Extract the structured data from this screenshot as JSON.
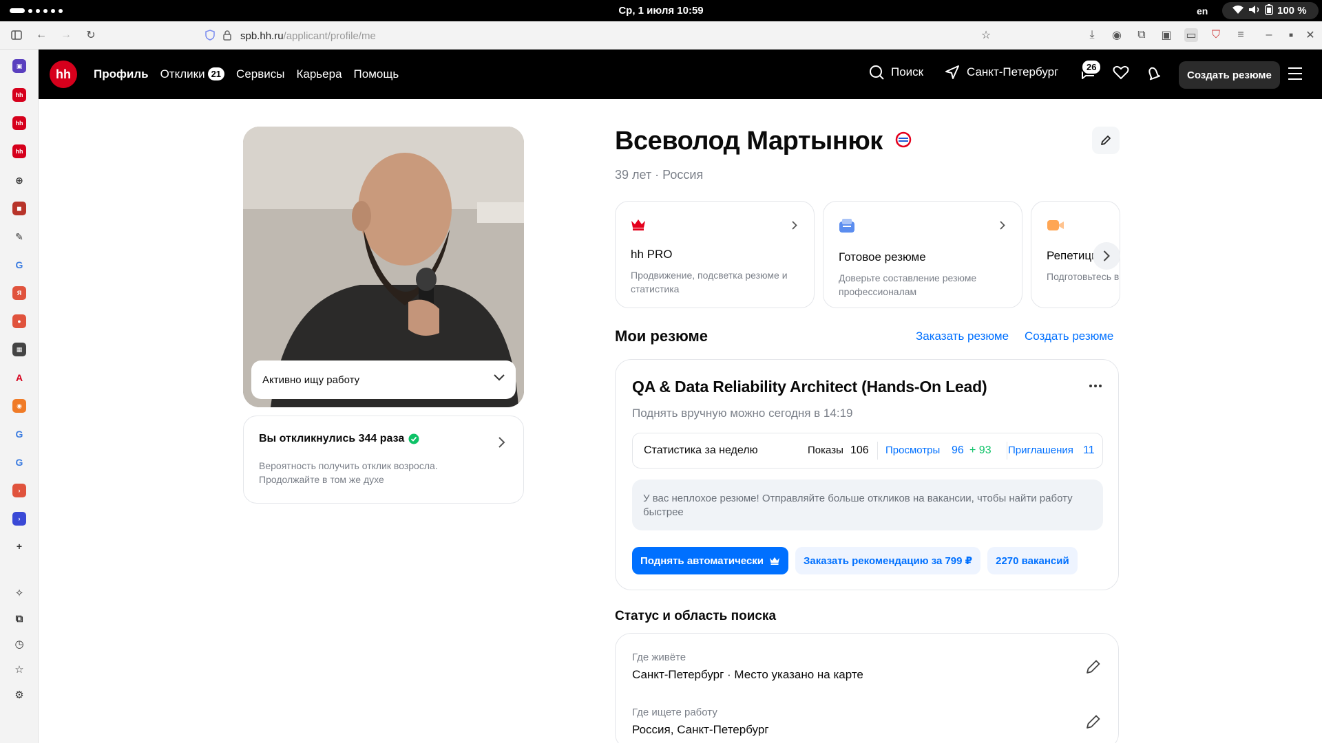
{
  "os": {
    "datetime": "Ср, 1 июля  10:59",
    "lang": "en",
    "battery": "100 %"
  },
  "browser": {
    "url_host": "spb.hh.ru",
    "url_path": "/applicant/profile/me"
  },
  "sidebar_icons": [
    "teams-icon",
    "hh-icon",
    "hh-icon",
    "hh-icon",
    "globe-icon",
    "app-icon",
    "extensions-icon",
    "google-icon",
    "yandex-icon",
    "maps-icon",
    "film-icon",
    "font-icon",
    "firefox-icon",
    "google-icon",
    "google-icon",
    "red-arrow-icon",
    "blue-arrow-icon",
    "add-icon"
  ],
  "header": {
    "logo": "hh",
    "nav": [
      {
        "label": "Профиль",
        "active": true
      },
      {
        "label": "Отклики",
        "badge": "21"
      },
      {
        "label": "Сервисы"
      },
      {
        "label": "Карьера"
      },
      {
        "label": "Помощь"
      }
    ],
    "search_label": "Поиск",
    "location_label": "Санкт-Петербург",
    "notifications_count": "26",
    "create_resume_label": "Создать резюме"
  },
  "profile": {
    "status_select": "Активно ищу работу",
    "responses_title": "Вы откликнулись 344 раза",
    "responses_text": "Вероятность получить отклик возросла. Продолжайте в том же духе",
    "name": "Всеволод Мартынюк",
    "meta": "39 лет · Россия"
  },
  "promos": [
    {
      "title": "hh PRO",
      "desc": "Продвижение, подсветка резюме и статистика",
      "icon": "crown-icon",
      "color": "#e4001c"
    },
    {
      "title": "Готовое резюме",
      "desc": "Доверьте составление резюме профессионалам",
      "icon": "resume-icon",
      "color": "#5b8def"
    },
    {
      "title": "Репетиции",
      "desc": "Подготовьтесь вместе с",
      "icon": "video-icon",
      "color": "#ffa654"
    }
  ],
  "my_resumes": {
    "title": "Мои резюме",
    "order_link": "Заказать резюме",
    "create_link": "Создать резюме"
  },
  "resume": {
    "title": "QA & Data Reliability Architect (Hands-On Lead)",
    "subtitle": "Поднять вручную можно сегодня в 14:19",
    "stats_label": "Статистика за неделю",
    "shows_label": "Показы",
    "shows_value": "106",
    "views_label": "Просмотры",
    "views_value": "96",
    "views_delta": "+ 93",
    "invites_label": "Приглашения",
    "invites_value": "11",
    "hint": "У вас неплохое резюме! Отправляйте больше откликов на вакансии, чтобы найти работу быстрее",
    "btn_auto": "Поднять автоматически",
    "btn_recommend": "Заказать рекомендацию за 799 ₽",
    "btn_vacancies": "2270 вакансий"
  },
  "search_status": {
    "title": "Статус и область поиска",
    "live_label": "Где живёте",
    "live_value": "Санкт-Петербург · Место указано на карте",
    "work_label": "Где ищете работу",
    "work_value": "Россия, Санкт-Петербург"
  },
  "colors": {
    "accent": "#0070ff",
    "brand": "#d6001c",
    "green": "#0dc267"
  }
}
